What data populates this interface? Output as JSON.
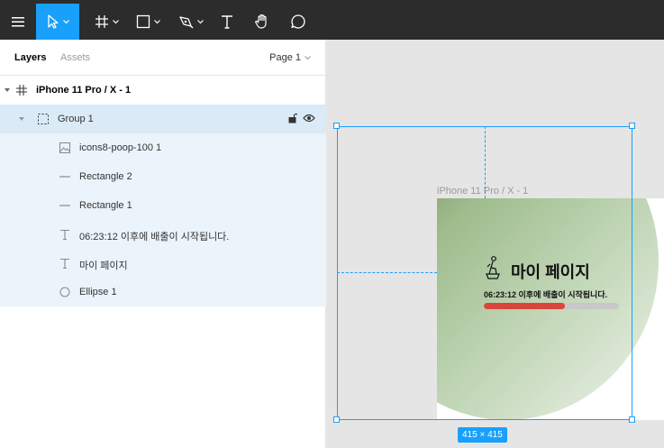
{
  "toolbar": {
    "tools": [
      {
        "name": "menu"
      },
      {
        "name": "move",
        "active": true
      },
      {
        "name": "frame"
      },
      {
        "name": "shape"
      },
      {
        "name": "pen"
      },
      {
        "name": "text"
      },
      {
        "name": "hand"
      },
      {
        "name": "comment"
      }
    ],
    "active_color": "#18a0fb"
  },
  "panel": {
    "tabs": {
      "layers": "Layers",
      "assets": "Assets"
    },
    "page_label": "Page 1"
  },
  "layers": [
    {
      "label": "iPhone 11 Pro / X - 1",
      "type": "frame"
    },
    {
      "label": "Group 1",
      "type": "group"
    },
    {
      "label": "icons8-poop-100 1",
      "type": "image"
    },
    {
      "label": "Rectangle 2",
      "type": "rectangle"
    },
    {
      "label": "Rectangle 1",
      "type": "rectangle"
    },
    {
      "label": "06:23:12 이후에 배출이 시작됩니다.",
      "type": "text"
    },
    {
      "label": "마이 페이지",
      "type": "text"
    },
    {
      "label": "Ellipse 1",
      "type": "ellipse"
    }
  ],
  "canvas": {
    "frame_title": "iPhone 11 Pro / X - 1",
    "app_title": "마이 페이지",
    "status_text": "06:23:12 이후에 배출이 시작됩니다.",
    "progress": 0.6,
    "progress_color": "#d9453b",
    "size_badge": "415 × 415"
  }
}
